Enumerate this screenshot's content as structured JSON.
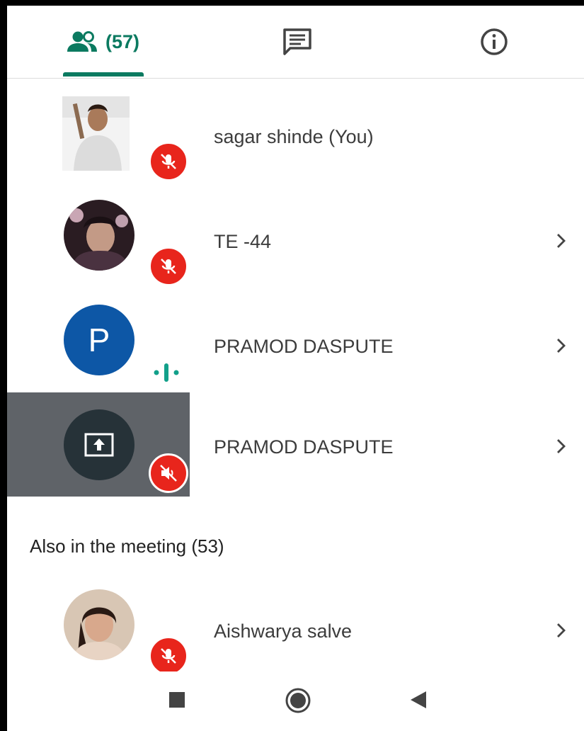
{
  "tabs": {
    "people_count": "(57)",
    "active": "people"
  },
  "participants": [
    {
      "name": "sagar shinde (You)",
      "avatar": "photo",
      "status": "mic-off",
      "has_chevron": false
    },
    {
      "name": "TE -44",
      "avatar": "photo",
      "status": "mic-off",
      "has_chevron": true
    },
    {
      "name": "PRAMOD DASPUTE",
      "avatar_letter": "P",
      "avatar_color": "#0d57a6",
      "status": "speaking",
      "has_chevron": true
    },
    {
      "name": "PRAMOD DASPUTE",
      "avatar": "presentation",
      "status": "volume-off",
      "has_chevron": true
    }
  ],
  "also_in_meeting": {
    "heading": "Also in the meeting (53)",
    "participants": [
      {
        "name": "Aishwarya salve",
        "avatar": "photo",
        "status": "mic-off",
        "has_chevron": true
      }
    ]
  },
  "colors": {
    "accent": "#0b7a60",
    "muted_badge": "#e8251c",
    "letter_avatar": "#0d57a6",
    "presenting_row": "#5f6368"
  }
}
